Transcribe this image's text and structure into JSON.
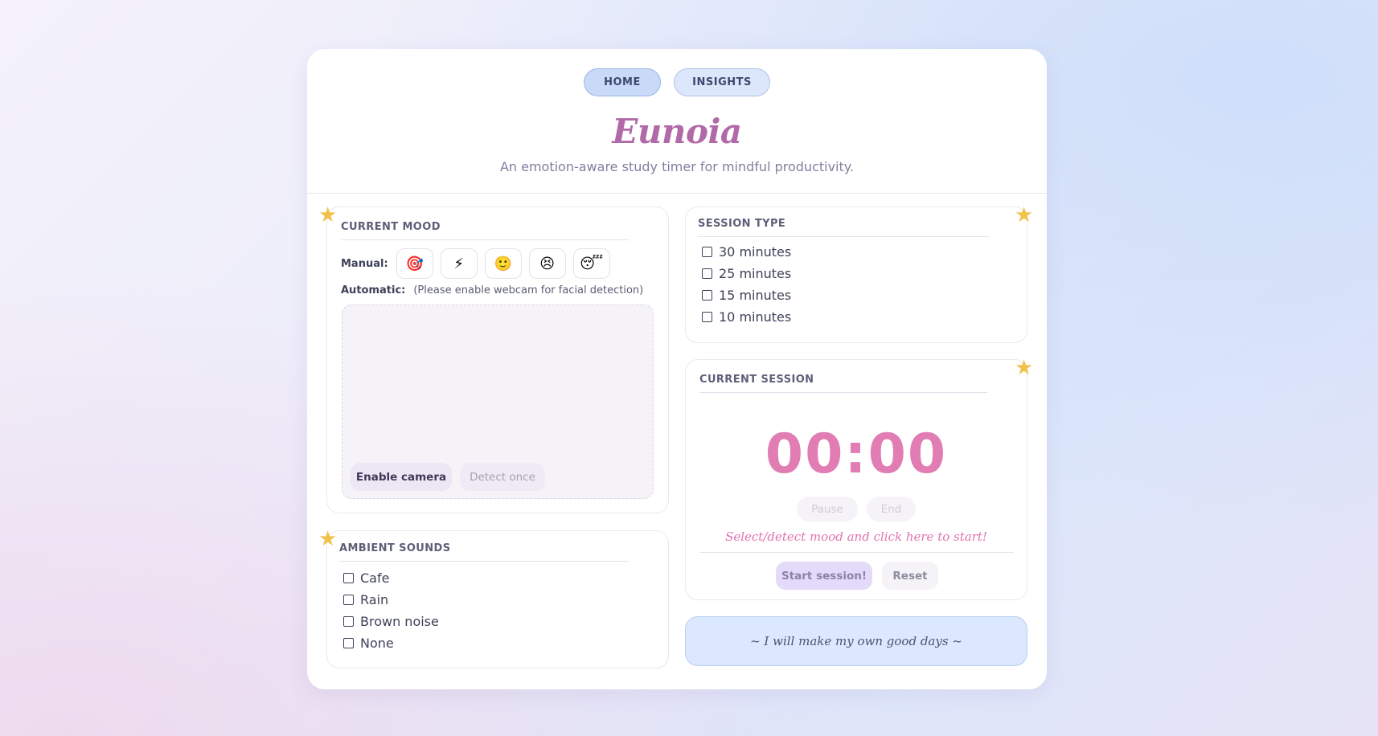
{
  "nav": {
    "tabs": [
      {
        "label": "HOME"
      },
      {
        "label": "INSIGHTS"
      }
    ]
  },
  "header": {
    "title": "Eunoia",
    "subtitle": "An emotion-aware study timer for mindful productivity."
  },
  "mood": {
    "heading": "CURRENT MOOD",
    "manual_label": "Manual:",
    "emojis": [
      "🎯",
      "⚡",
      "🙂",
      "😣",
      "😴"
    ],
    "automatic_label": "Automatic:",
    "automatic_note": "(Please enable webcam for facial detection)",
    "enable_camera": "Enable camera",
    "detect_once": "Detect once"
  },
  "ambient": {
    "heading": "AMBIENT SOUNDS",
    "options": [
      "Cafe",
      "Rain",
      "Brown noise",
      "None"
    ]
  },
  "session_type": {
    "heading": "SESSION TYPE",
    "options": [
      "30 minutes",
      "25 minutes",
      "15 minutes",
      "10 minutes"
    ]
  },
  "current_session": {
    "heading": "CURRENT SESSION",
    "timer": "00:00",
    "pause": "Pause",
    "end": "End",
    "hint": "Select/detect mood and click here to start!",
    "start": "Start session!",
    "reset": "Reset"
  },
  "quote": "~ I will make my own good days ~",
  "colors": {
    "accent_pink": "#e27db4",
    "title_purple": "#b06aa8",
    "star": "#f0c24a",
    "nav_blue": "#dce7fb"
  }
}
